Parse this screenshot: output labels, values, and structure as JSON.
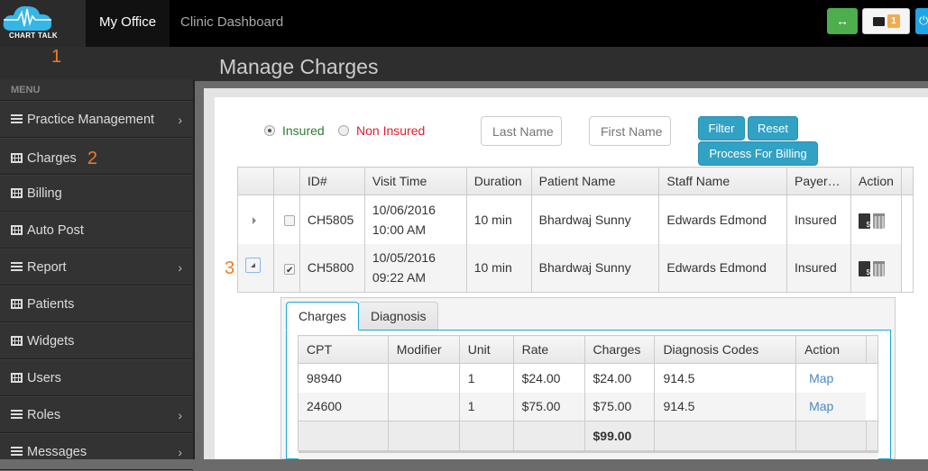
{
  "brand": {
    "logo_text": "CHART TALK"
  },
  "topnav": {
    "items": [
      {
        "label": "My Office",
        "active": true
      },
      {
        "label": "Clinic Dashboard",
        "active": false
      }
    ]
  },
  "topright": {
    "expand_icon": "↔",
    "mail_count": "1",
    "power_icon": "⏻"
  },
  "annotations": {
    "one": "1",
    "two": "2",
    "three": "3"
  },
  "page": {
    "title": "Manage Charges"
  },
  "sidebar": {
    "header": "MENU",
    "items": [
      {
        "label": "Practice Management",
        "icon": "list-icon",
        "has_submenu": true
      },
      {
        "label": "Charges",
        "icon": "grid-icon",
        "has_submenu": false
      },
      {
        "label": "Billing",
        "icon": "grid-icon",
        "has_submenu": false
      },
      {
        "label": "Auto Post",
        "icon": "grid-icon",
        "has_submenu": false
      },
      {
        "label": "Report",
        "icon": "list-icon",
        "has_submenu": true
      },
      {
        "label": "Patients",
        "icon": "grid-icon",
        "has_submenu": false
      },
      {
        "label": "Widgets",
        "icon": "grid-icon",
        "has_submenu": false
      },
      {
        "label": "Users",
        "icon": "grid-icon",
        "has_submenu": false
      },
      {
        "label": "Roles",
        "icon": "list-icon",
        "has_submenu": true
      },
      {
        "label": "Messages",
        "icon": "list-icon",
        "has_submenu": true
      }
    ]
  },
  "filters": {
    "insured_label": "Insured",
    "non_insured_label": "Non Insured",
    "selected": "Insured",
    "last_name_placeholder": "Last Name",
    "first_name_placeholder": "First Name",
    "filter_label": "Filter",
    "reset_label": "Reset",
    "process_label": "Process For Billing",
    "colors": {
      "insured": "#2e7d32",
      "non_insured": "#e8192c",
      "button": "#31a1c4"
    }
  },
  "charges_table": {
    "headers": [
      "",
      "",
      "ID#",
      "Visit Time",
      "Duration",
      "Patient Name",
      "Staff Name",
      "Payer…",
      "Action"
    ],
    "rows": [
      {
        "expanded": false,
        "checked": false,
        "id": "CH5805",
        "visit_date": "10/06/2016",
        "visit_time": "10:00 AM",
        "duration": "10 min",
        "patient": "Bhardwaj Sunny",
        "staff": "Edwards Edmond",
        "payer": "Insured"
      },
      {
        "expanded": true,
        "checked": true,
        "id": "CH5800",
        "visit_date": "10/05/2016",
        "visit_time": "09:22 AM",
        "duration": "10 min",
        "patient": "Bhardwaj Sunny",
        "staff": "Edwards Edmond",
        "payer": "Insured"
      }
    ]
  },
  "detail": {
    "tabs": [
      {
        "label": "Charges",
        "active": true
      },
      {
        "label": "Diagnosis",
        "active": false
      }
    ],
    "headers": [
      "CPT",
      "Modifier",
      "Unit",
      "Rate",
      "Charges",
      "Diagnosis Codes",
      "Action"
    ],
    "rows": [
      {
        "cpt": "98940",
        "modifier": "",
        "unit": "1",
        "rate": "$24.00",
        "charges": "$24.00",
        "diagnosis": "914.5",
        "action": "Map"
      },
      {
        "cpt": "24600",
        "modifier": "",
        "unit": "1",
        "rate": "$75.00",
        "charges": "$75.00",
        "diagnosis": "914.5",
        "action": "Map"
      }
    ],
    "total": "$99.00"
  }
}
